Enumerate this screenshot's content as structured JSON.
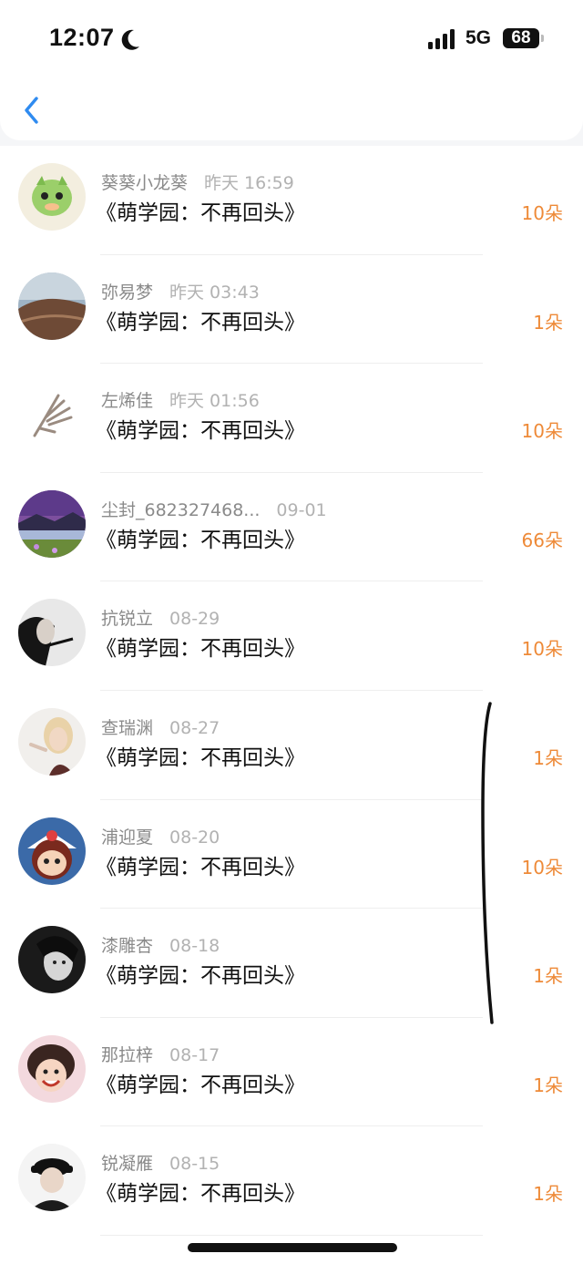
{
  "status_bar": {
    "time": "12:07",
    "network": "5G",
    "battery": "68"
  },
  "rows": [
    {
      "name": "葵葵小龙葵",
      "time": "昨天 16:59",
      "title": "《萌学园：不再回头》",
      "amount": "10朵",
      "avatar": "green-dragon-avatar"
    },
    {
      "name": "弥易梦",
      "time": "昨天 03:43",
      "title": "《萌学园：不再回头》",
      "amount": "1朵",
      "avatar": "seaside-rock-avatar"
    },
    {
      "name": "左烯佳",
      "time": "昨天 01:56",
      "title": "《萌学园：不再回头》",
      "amount": "10朵",
      "avatar": "hand-sketch-avatar"
    },
    {
      "name": "尘封_682327468...",
      "time": "09-01",
      "title": "《萌学园：不再回头》",
      "amount": "66朵",
      "avatar": "purple-landscape-avatar"
    },
    {
      "name": "抗锐立",
      "time": "08-29",
      "title": "《萌学园：不再回头》",
      "amount": "10朵",
      "avatar": "woman-bw-avatar"
    },
    {
      "name": "查瑞渊",
      "time": "08-27",
      "title": "《萌学园：不再回头》",
      "amount": "1朵",
      "avatar": "blonde-woman-avatar"
    },
    {
      "name": "浦迎夏",
      "time": "08-20",
      "title": "《萌学园：不再回头》",
      "amount": "10朵",
      "avatar": "cartoon-girl-avatar"
    },
    {
      "name": "漆雕杏",
      "time": "08-18",
      "title": "《萌学园：不再回头》",
      "amount": "1朵",
      "avatar": "dark-portrait-avatar"
    },
    {
      "name": "那拉梓",
      "time": "08-17",
      "title": "《萌学园：不再回头》",
      "amount": "1朵",
      "avatar": "smiling-child-avatar"
    },
    {
      "name": "锐凝雁",
      "time": "08-15",
      "title": "《萌学园：不再回头》",
      "amount": "1朵",
      "avatar": "hat-boy-avatar"
    }
  ],
  "colors": {
    "accent_blue": "#2f8bf0",
    "amount_orange": "#ee8a38"
  }
}
